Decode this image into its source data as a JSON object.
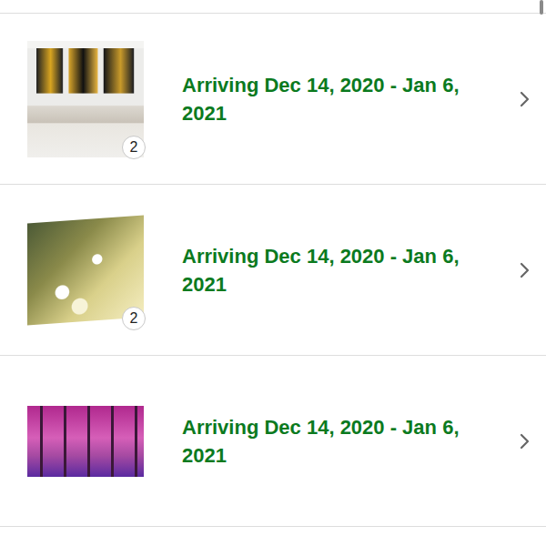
{
  "orders": [
    {
      "status": "Arriving Dec 14, 2020 - Jan 6, 2021",
      "quantity": "2"
    },
    {
      "status": "Arriving Dec 14, 2020 - Jan 6, 2021",
      "quantity": "2"
    },
    {
      "status": "Arriving Dec 14, 2020 - Jan 6, 2021"
    }
  ]
}
